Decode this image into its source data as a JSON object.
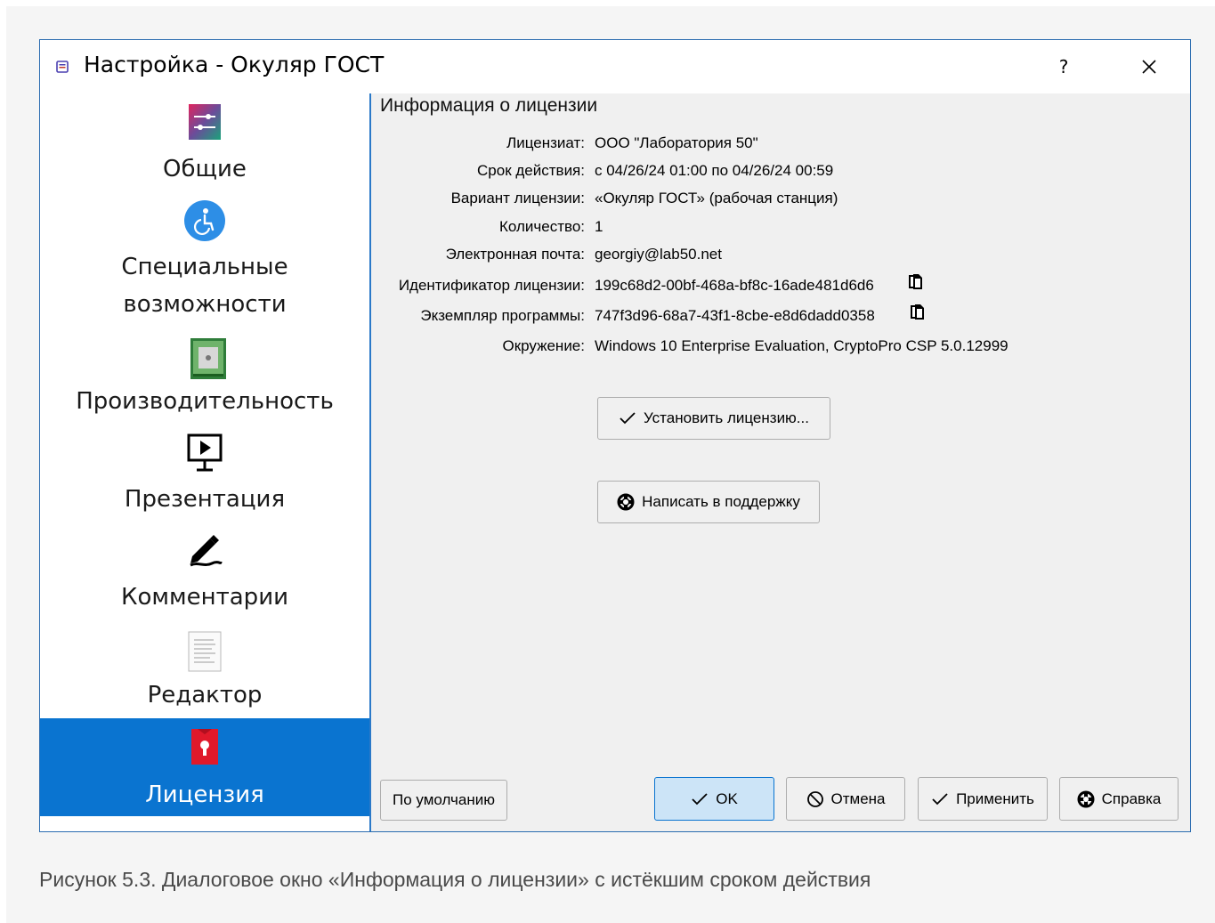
{
  "window": {
    "title": "Настройка - Окуляр ГОСТ",
    "help_label": "?",
    "close_icon": "close-icon"
  },
  "sidebar": {
    "items": [
      {
        "label": "Общие",
        "icon": "settings-sliders-icon"
      },
      {
        "label": "Специальные возможности",
        "label_line1": "Специальные",
        "label_line2": "возможности",
        "icon": "accessibility-icon"
      },
      {
        "label": "Производительность",
        "icon": "performance-chip-icon"
      },
      {
        "label": "Презентация",
        "icon": "presentation-icon"
      },
      {
        "label": "Комментарии",
        "icon": "pen-icon"
      },
      {
        "label": "Редактор",
        "icon": "document-icon"
      },
      {
        "label": "Лицензия",
        "icon": "license-icon",
        "active": true
      }
    ]
  },
  "license": {
    "section_title": "Информация о лицензии",
    "rows": [
      {
        "label": "Лицензиат:",
        "value": "ООО \"Лаборатория 50\""
      },
      {
        "label": "Срок действия:",
        "value": "с 04/26/24 01:00 по 04/26/24 00:59"
      },
      {
        "label": "Вариант лицензии:",
        "value": "«Окуляр ГОСТ» (рабочая станция)"
      },
      {
        "label": "Количество:",
        "value": "1"
      },
      {
        "label": "Электронная почта:",
        "value": "georgiy@lab50.net"
      },
      {
        "label": "Идентификатор лицензии:",
        "value": "199c68d2-00bf-468a-bf8c-16ade481d6d6",
        "copy": true
      },
      {
        "label": "Экземпляр программы:",
        "value": "747f3d96-68a7-43f1-8cbe-e8d6dadd0358",
        "copy": true
      },
      {
        "label": "Окружение:",
        "value": "Windows 10 Enterprise Evaluation, CryptoPro CSP 5.0.12999"
      }
    ],
    "install_button": "Установить лицензию...",
    "support_button": "Написать в поддержку"
  },
  "footer": {
    "defaults_button": "По умолчанию",
    "ok_button": "OK",
    "cancel_button": "Отмена",
    "apply_button": "Применить",
    "help_button": "Справка"
  },
  "caption": "Рисунок 5.3. Диалоговое окно «Информация о лицензии» с истёкшим сроком действия",
  "colors": {
    "accent": "#0a74d0",
    "selection_text": "#ffffff",
    "dialog_bg": "#f0f0f0"
  }
}
